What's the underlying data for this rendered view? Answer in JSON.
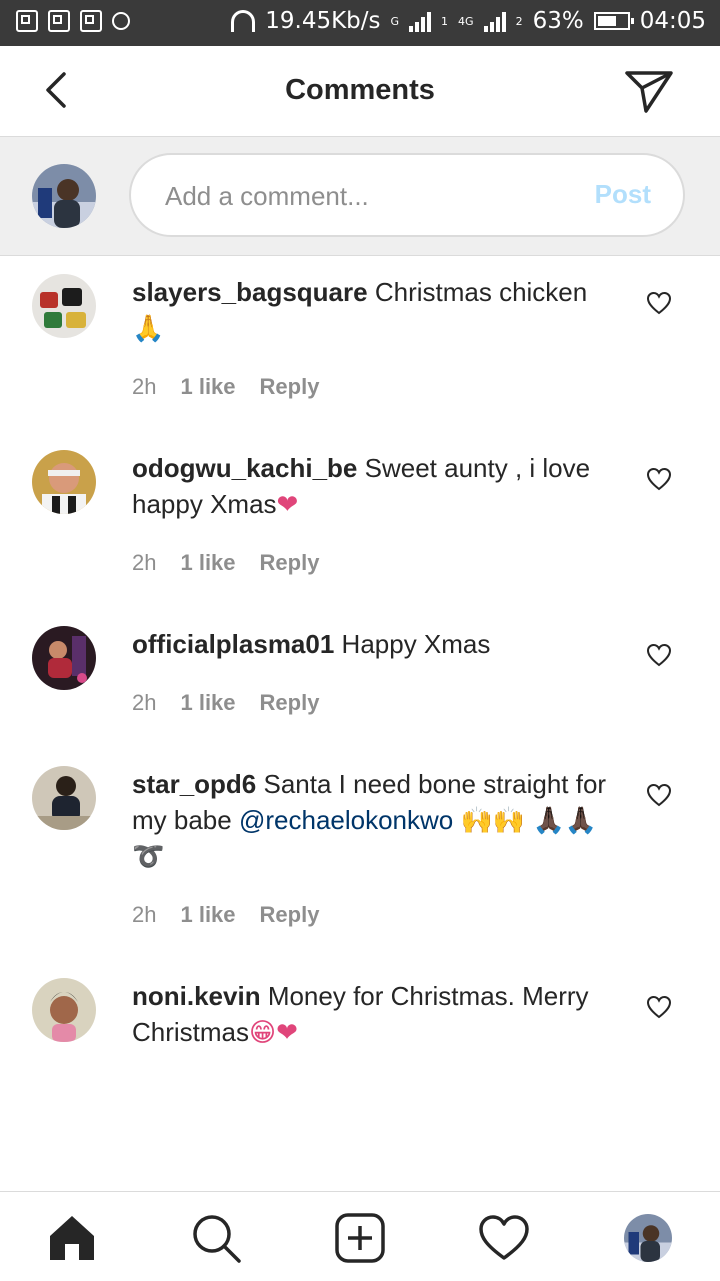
{
  "status_bar": {
    "network_speed": "19.45Kb/s",
    "network_type_1": "G",
    "network_type_2": "4G",
    "sim_1": "1",
    "sim_2": "2",
    "battery": "63%",
    "battery_level": 0.63,
    "time": "04:05"
  },
  "header": {
    "title": "Comments",
    "back_icon": "chevron-left-icon",
    "share_icon": "paper-plane-icon"
  },
  "composer": {
    "placeholder": "Add a comment...",
    "post_label": "Post"
  },
  "comments": [
    {
      "username": "slayers_bagsquare",
      "text": "Christmas chicken",
      "emoji": "🙏",
      "time": "2h",
      "likes": "1 like",
      "reply": "Reply"
    },
    {
      "username": "odogwu_kachi_be",
      "text": "Sweet aunty , i love happy Xmas",
      "emoji": "❤",
      "time": "2h",
      "likes": "1 like",
      "reply": "Reply"
    },
    {
      "username": "officialplasma01",
      "text": "Happy Xmas",
      "emoji": "",
      "time": "2h",
      "likes": "1 like",
      "reply": "Reply"
    },
    {
      "username": "star_opd6",
      "text": "Santa I need bone straight for my babe",
      "mention": "@rechaelokonkwo",
      "emoji_1": "🙌🙌",
      "emoji_2": "🙏🏿🙏🏿➰",
      "time": "2h",
      "likes": "1 like",
      "reply": "Reply"
    },
    {
      "username": "noni.kevin",
      "text": "Money for Christmas. Merry Christmas",
      "emoji": "😁❤",
      "time": "",
      "likes": "",
      "reply": ""
    }
  ],
  "bottom_nav": {
    "items": [
      "home-icon",
      "search-icon",
      "add-post-icon",
      "activity-heart-icon",
      "profile-avatar"
    ]
  },
  "colors": {
    "accent_post_disabled": "#b2dffc",
    "mention": "#003569",
    "heart_emoji": "#e0457a",
    "muted": "#8e8e8e"
  }
}
